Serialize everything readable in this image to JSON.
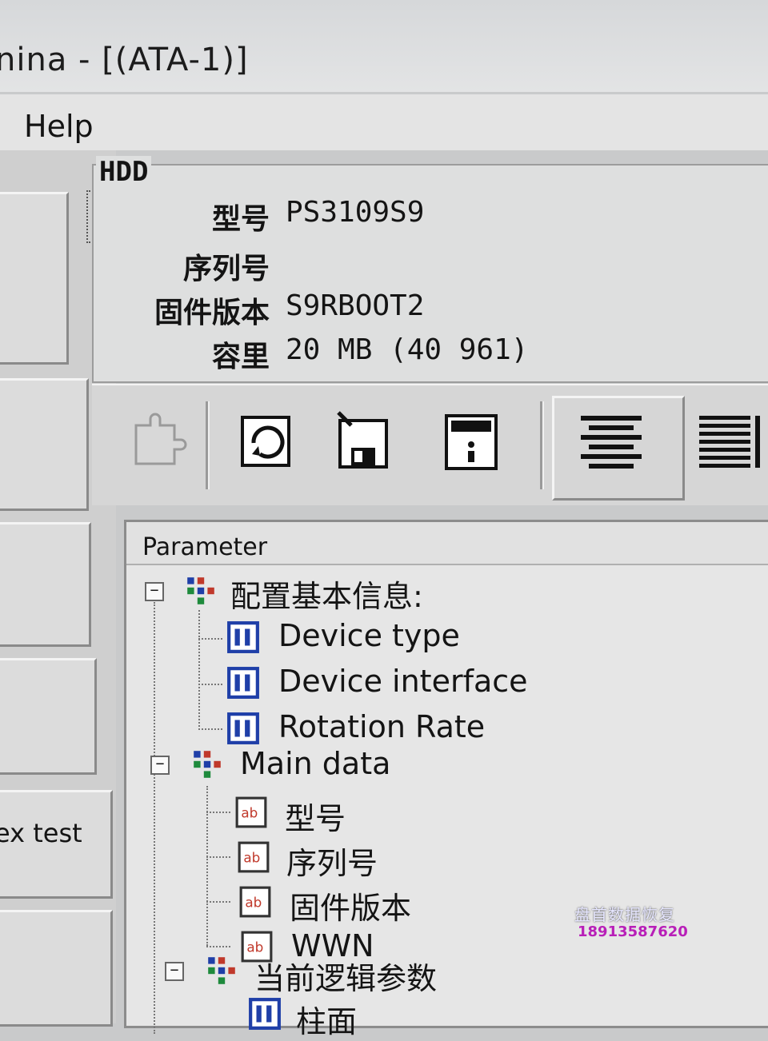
{
  "window": {
    "title": "nina - [(ATA-1)]"
  },
  "menu": {
    "help": "Help"
  },
  "left_panel": {
    "button_label": "ex test"
  },
  "hdd": {
    "legend": "HDD",
    "fields": [
      {
        "label": "型号",
        "value": "PS3109S9"
      },
      {
        "label": "序列号",
        "value": ""
      },
      {
        "label": "固件版本",
        "value": "S9RBOOT2"
      },
      {
        "label": "容里",
        "value": "20 MB (40 961)"
      }
    ]
  },
  "tree": {
    "header": "Parameter",
    "groups": [
      {
        "label": "配置基本信息:",
        "items": [
          "Device type",
          "Device interface",
          "Rotation Rate"
        ]
      },
      {
        "label": "Main data",
        "items": [
          "型号",
          "序列号",
          "固件版本",
          "WWN"
        ]
      },
      {
        "label": "当前逻辑参数",
        "items": [
          "柱面"
        ]
      }
    ]
  },
  "watermark": {
    "line1": "盘首数据恢复",
    "line2": "18913587620"
  },
  "colors": {
    "accent_red": "#c0392b",
    "node_green": "#1e8a3c",
    "node_blue": "#1f3fa8",
    "watermark_pink": "#b81fb8"
  }
}
